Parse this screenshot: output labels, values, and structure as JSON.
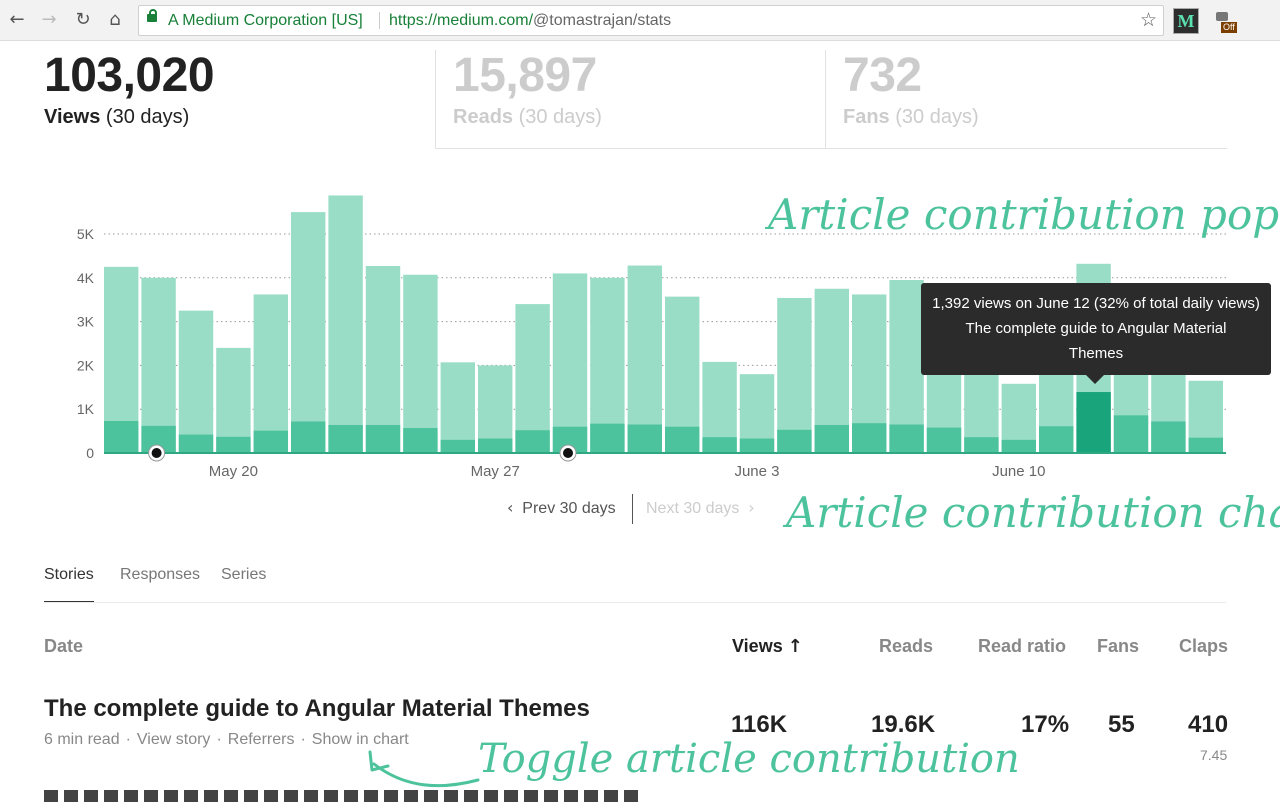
{
  "browser": {
    "back_icon": "arrow-left-icon",
    "security_label": "A Medium Corporation [US]",
    "url_host": "https://medium.com/",
    "url_path": "@tomastrajan/stats"
  },
  "stats": [
    {
      "value": "103,020",
      "label": "Views",
      "period": "(30 days)"
    },
    {
      "value": "15,897",
      "label": "Reads",
      "period": "(30 days)"
    },
    {
      "value": "732",
      "label": "Fans",
      "period": "(30 days)"
    }
  ],
  "chart_data": {
    "type": "bar",
    "ylim": [
      0,
      5500
    ],
    "y_ticks": [
      0,
      1000,
      2000,
      3000,
      4000,
      5000
    ],
    "y_tick_labels": [
      "0",
      "1K",
      "2K",
      "3K",
      "4K",
      "5K"
    ],
    "x_labels": [
      {
        "index": 3,
        "label": "May 20"
      },
      {
        "index": 10,
        "label": "May 27"
      },
      {
        "index": 17,
        "label": "June 3"
      },
      {
        "index": 24,
        "label": "June 10"
      }
    ],
    "series": [
      {
        "values": [
          4250,
          4000,
          3250,
          2400,
          3620,
          5500,
          5880,
          4270,
          4070,
          2070,
          2000,
          3400,
          4100,
          4000,
          4280,
          3570,
          2080,
          1800,
          3540,
          3750,
          3620,
          3950,
          3700,
          2750,
          1580,
          2500,
          4320,
          3300,
          3100,
          1650
        ]
      },
      {
        "values": [
          730,
          620,
          420,
          370,
          510,
          720,
          640,
          640,
          570,
          300,
          330,
          520,
          600,
          670,
          650,
          600,
          360,
          330,
          530,
          640,
          680,
          650,
          580,
          360,
          300,
          610,
          1392,
          860,
          720,
          350
        ]
      }
    ],
    "highlight_index": 26,
    "markers": [
      1,
      12
    ],
    "colors": {
      "total": "#9addc6",
      "article": "#4cc39c",
      "highlight": "#19a47c",
      "grid": "#999999",
      "marker": "#111111"
    }
  },
  "pager": {
    "prev": "Prev 30 days",
    "next": "Next 30 days"
  },
  "annotations": {
    "popup": "Article contribution popup",
    "chart": "Article contribution chart",
    "toggle": "Toggle article contribution"
  },
  "tooltip": {
    "line1": "1,392 views on June 12 (32% of total daily views)",
    "line2": "The complete guide to Angular Material",
    "line3": "Themes"
  },
  "tabs": [
    "Stories",
    "Responses",
    "Series"
  ],
  "table": {
    "headers": {
      "date": "Date",
      "views": "Views",
      "reads": "Reads",
      "read_ratio": "Read ratio",
      "fans": "Fans",
      "claps": "Claps"
    },
    "sort_icon": "arrow-up-icon",
    "rows": [
      {
        "title": "The complete guide to Angular Material Themes",
        "meta": [
          "6 min read",
          "View story",
          "Referrers",
          "Show in chart"
        ],
        "views": "116K",
        "reads": "19.6K",
        "read_ratio": "17%",
        "fans": "55",
        "claps": "410",
        "claps_sub": "7.45"
      }
    ]
  }
}
